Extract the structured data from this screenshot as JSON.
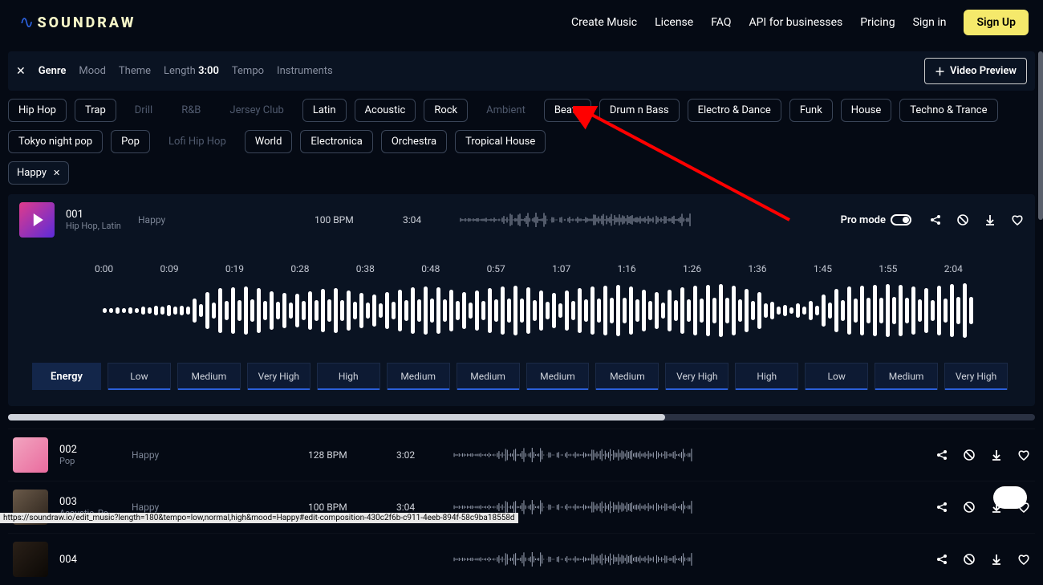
{
  "brand": {
    "name": "SOUNDRAW"
  },
  "nav": {
    "create": "Create Music",
    "license": "License",
    "faq": "FAQ",
    "api": "API for businesses",
    "pricing": "Pricing",
    "signin": "Sign in",
    "signup": "Sign Up"
  },
  "filters": {
    "genre": "Genre",
    "mood": "Mood",
    "theme": "Theme",
    "length_label": "Length",
    "length_value": "3:00",
    "tempo": "Tempo",
    "instruments": "Instruments",
    "video_preview": "Video Preview"
  },
  "genres": [
    {
      "label": "Hip Hop",
      "dim": false
    },
    {
      "label": "Trap",
      "dim": false
    },
    {
      "label": "Drill",
      "dim": true
    },
    {
      "label": "R&B",
      "dim": true
    },
    {
      "label": "Jersey Club",
      "dim": true
    },
    {
      "label": "Latin",
      "dim": false
    },
    {
      "label": "Acoustic",
      "dim": false
    },
    {
      "label": "Rock",
      "dim": false
    },
    {
      "label": "Ambient",
      "dim": true
    },
    {
      "label": "Beats",
      "dim": false
    },
    {
      "label": "Drum n Bass",
      "dim": false
    },
    {
      "label": "Electro & Dance",
      "dim": false
    },
    {
      "label": "Funk",
      "dim": false
    },
    {
      "label": "House",
      "dim": false
    },
    {
      "label": "Techno & Trance",
      "dim": false
    },
    {
      "label": "Tokyo night pop",
      "dim": false
    },
    {
      "label": "Pop",
      "dim": false
    },
    {
      "label": "Lofi Hip Hop",
      "dim": true
    },
    {
      "label": "World",
      "dim": false
    },
    {
      "label": "Electronica",
      "dim": false
    },
    {
      "label": "Orchestra",
      "dim": false
    },
    {
      "label": "Tropical House",
      "dim": false
    }
  ],
  "selected_mood": "Happy",
  "expanded_track": {
    "id": "001",
    "sub": "Hip Hop, Latin",
    "mood": "Happy",
    "bpm": "100 BPM",
    "duration": "3:04",
    "pro_mode": "Pro mode"
  },
  "timeline_ticks": [
    "0:00",
    "0:09",
    "0:19",
    "0:28",
    "0:38",
    "0:48",
    "0:57",
    "1:07",
    "1:16",
    "1:26",
    "1:36",
    "1:45",
    "1:55",
    "2:04"
  ],
  "energy": {
    "label": "Energy",
    "cells": [
      "Low",
      "Medium",
      "Very High",
      "High",
      "Medium",
      "Medium",
      "Medium",
      "Medium",
      "Very High",
      "High",
      "Low",
      "Medium",
      "Very High"
    ]
  },
  "tracks": [
    {
      "id": "002",
      "sub": "Pop",
      "mood": "Happy",
      "bpm": "128 BPM",
      "duration": "3:02",
      "thumb_bg": "linear-gradient(135deg,#f2a5c0,#e96b9e)"
    },
    {
      "id": "003",
      "sub": "Acoustic, Po...",
      "mood": "Happy",
      "bpm": "100 BPM",
      "duration": "3:04",
      "thumb_bg": "linear-gradient(135deg,#6a5a4a,#2b221a)"
    },
    {
      "id": "004",
      "sub": "",
      "mood": "",
      "bpm": "",
      "duration": "",
      "thumb_bg": "linear-gradient(135deg,#2a2018,#0b0805)"
    }
  ],
  "status_url": "https://soundraw.io/edit_music?length=180&tempo=low,normal,high&mood=Happy#edit-composition-430c2f6b-c911-4eeb-894f-58c9ba18558d",
  "colors": {
    "accent_yellow": "#f5e96b",
    "accent_blue": "#2b5fd9"
  }
}
